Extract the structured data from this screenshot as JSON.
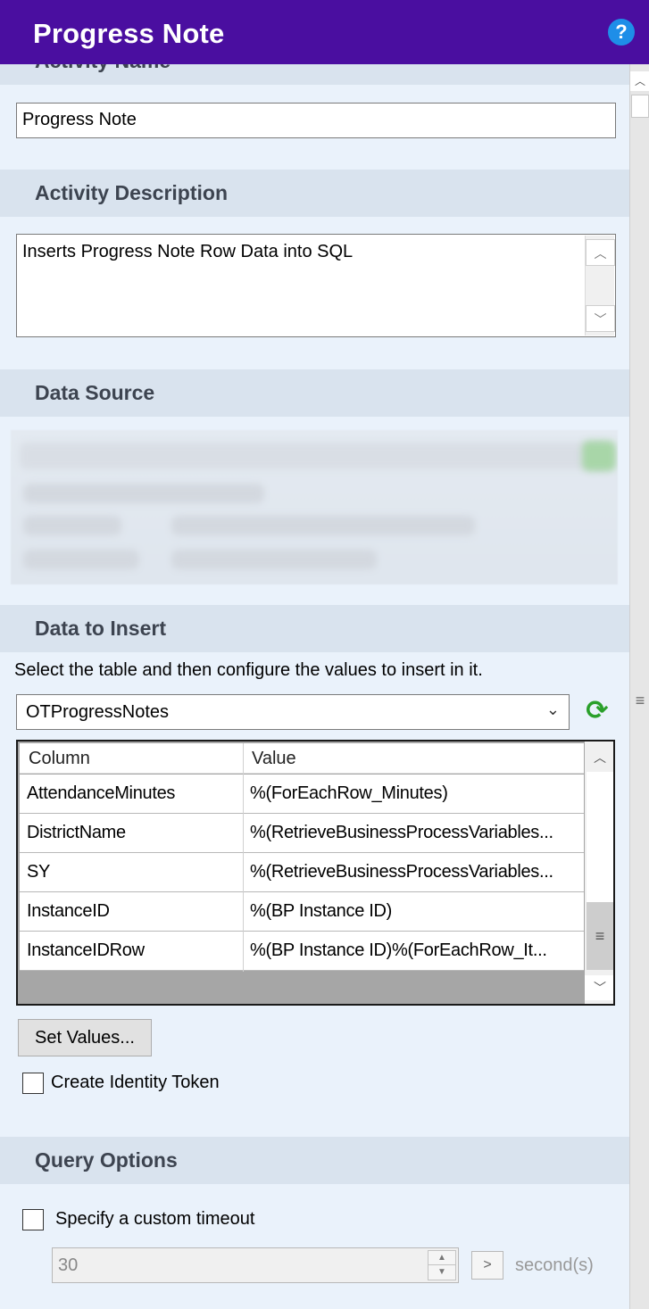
{
  "window": {
    "title": "Progress Note",
    "help_icon": "?"
  },
  "activity_name": {
    "header": "Activity Name",
    "value": "Progress Note"
  },
  "activity_description": {
    "header": "Activity Description",
    "value": "Inserts Progress Note Row Data into SQL"
  },
  "data_source": {
    "header": "Data Source"
  },
  "data_to_insert": {
    "header": "Data to Insert",
    "instruction": "Select the table and then configure the values to insert in it.",
    "table_select": "OTProgressNotes",
    "grid": {
      "columns": [
        "Column",
        "Value"
      ],
      "rows": [
        {
          "column": "AttendanceMinutes",
          "value": "%(ForEachRow_Minutes)"
        },
        {
          "column": "DistrictName",
          "value": "%(RetrieveBusinessProcessVariables..."
        },
        {
          "column": "SY",
          "value": "%(RetrieveBusinessProcessVariables..."
        },
        {
          "column": "InstanceID",
          "value": "%(BP Instance ID)"
        },
        {
          "column": "InstanceIDRow",
          "value": "%(BP Instance ID)%(ForEachRow_It..."
        }
      ]
    },
    "set_values_button": "Set Values...",
    "create_identity_token": "Create Identity Token"
  },
  "query_options": {
    "header": "Query Options",
    "custom_timeout_label": "Specify a custom timeout",
    "timeout_value": "30",
    "expand_button": ">",
    "unit_label": "second(s)"
  },
  "colors": {
    "title_bar": "#4a0ea0",
    "section_header": "#d9e3ee",
    "panel_background": "#eaf2fb",
    "help_icon": "#1e8ee8",
    "refresh_icon": "#2aa02a"
  }
}
